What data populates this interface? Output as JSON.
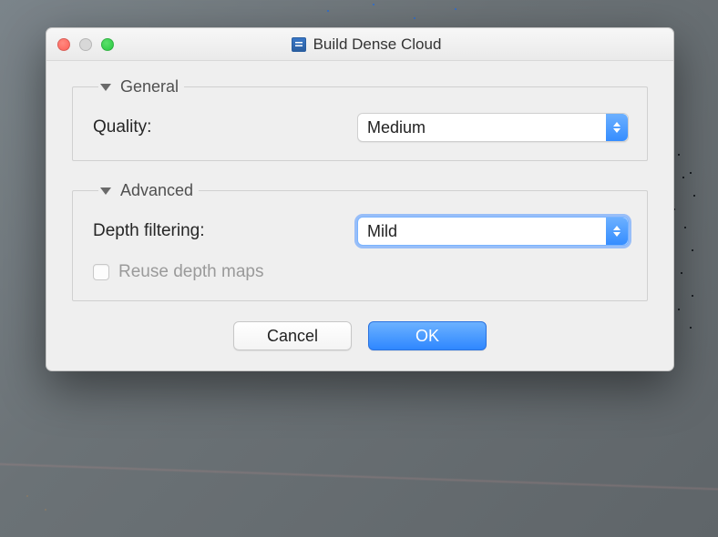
{
  "dialog": {
    "title": "Build Dense Cloud",
    "general": {
      "legend": "General",
      "quality_label": "Quality:",
      "quality_value": "Medium"
    },
    "advanced": {
      "legend": "Advanced",
      "depth_label": "Depth filtering:",
      "depth_value": "Mild",
      "reuse_label": "Reuse depth maps",
      "reuse_checked": false
    },
    "buttons": {
      "cancel": "Cancel",
      "ok": "OK"
    }
  }
}
